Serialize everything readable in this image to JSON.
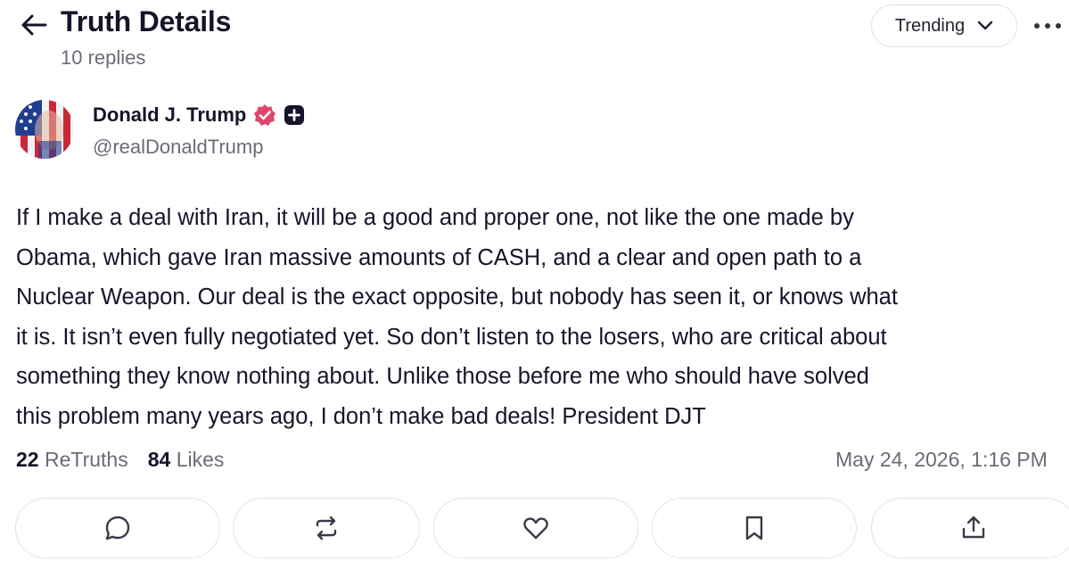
{
  "header": {
    "title": "Truth Details",
    "replies": "10 replies",
    "sort_label": "Trending"
  },
  "author": {
    "name": "Donald J. Trump",
    "handle": "@realDonaldTrump",
    "verified_color": "#e0456a"
  },
  "post": {
    "lines": [
      "If I make a deal with Iran, it will be a good and proper one, not like the one made by",
      "Obama, which gave Iran massive amounts of CASH, and a clear and open path to a",
      "Nuclear Weapon. Our deal is the exact opposite, but nobody has seen it, or knows what",
      "it is. It isn’t even fully negotiated yet. So don’t listen to the losers, who are critical about",
      "something they know nothing about. Unlike those before me who should have solved",
      "this problem many years ago, I don’t make bad deals! President DJT"
    ]
  },
  "stats": {
    "retruths_count": "22",
    "retruths_label": "ReTruths",
    "likes_count": "84",
    "likes_label": "Likes",
    "timestamp": "May 24, 2026, 1:16 PM"
  },
  "actions": [
    "comment-icon",
    "retruth-icon",
    "heart-icon",
    "bookmark-icon",
    "share-icon"
  ]
}
